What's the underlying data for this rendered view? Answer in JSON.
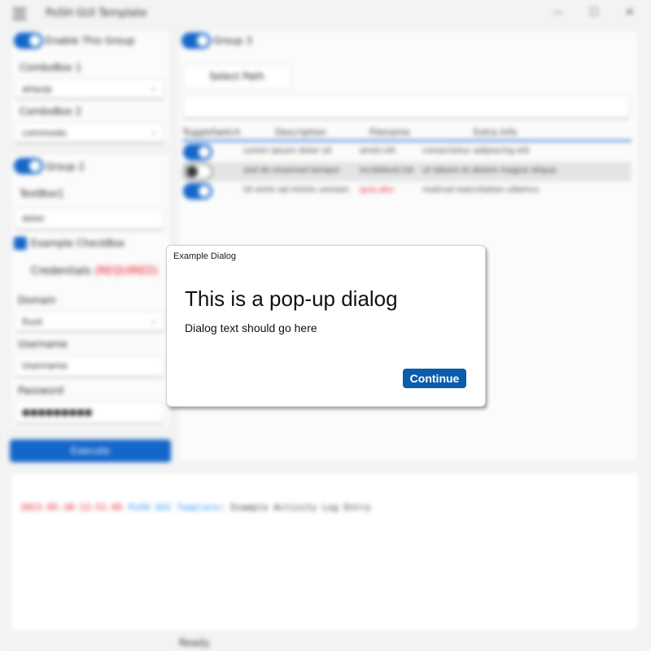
{
  "app": {
    "title": "PoSH GUI Template",
    "menu_icon": "hamburger-icon",
    "window_controls": {
      "minimize": "—",
      "maximize": "☐",
      "close": "✕"
    }
  },
  "group1": {
    "toggle_label": "Enable This Group",
    "combo1_label": "ComboBox 1",
    "combo1_value": "aliquip",
    "combo2_label": "ComboBox 2",
    "combo2_value": "commodo"
  },
  "group2": {
    "toggle_label": "Group 2",
    "textbox_label": "TextBox1",
    "textbox_value": "dolor",
    "checkbox_label": "Example CheckBox",
    "credentials_title": "Credentials",
    "credentials_required": "(REQUIRED)",
    "domain_label": "Domain",
    "domain_value": "Dust",
    "username_label": "Username",
    "username_placeholder": "Username",
    "password_label": "Password",
    "password_value": "●●●●●●●●●"
  },
  "execute_label": "Execute",
  "group3": {
    "toggle_label": "Group 3",
    "select_path_label": "Select Path",
    "path_value": "",
    "columns": [
      "ToggleSwitch",
      "Description",
      "Filename",
      "Extra Info"
    ],
    "rows": [
      {
        "toggle_on": true,
        "description": "Lorem ipsum dolor sit",
        "filename": "amet.nih",
        "extra": "consectetur adipiscing elit",
        "filename_red": false,
        "selected": false
      },
      {
        "toggle_on": false,
        "description": "sed do eiusmod tempor",
        "filename": "incididunt.txt",
        "extra": "ut labore et dolore magna aliqua",
        "filename_red": false,
        "selected": true
      },
      {
        "toggle_on": true,
        "description": "Ut enim ad minim veniam",
        "filename": "quis.dev",
        "extra": "nostrud exercitation ullamco",
        "filename_red": true,
        "selected": false
      }
    ]
  },
  "log": {
    "timestamp": "2023-05-30-13-51-05",
    "source": "PoSH GUI Template",
    "separator": ":",
    "message": "Example Activity Log Entry"
  },
  "status": {
    "text": "Ready."
  },
  "dialog": {
    "caption": "Example Dialog",
    "title": "This is a pop-up dialog",
    "text": "Dialog text should go here",
    "button": "Continue"
  },
  "colors": {
    "accent": "#1466c9",
    "dialog_button": "#0b5cad",
    "error": "#e81123",
    "log_source": "#1e8fff"
  }
}
